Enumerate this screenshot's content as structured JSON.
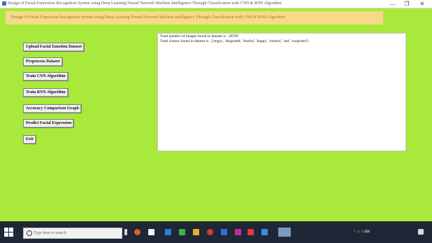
{
  "window": {
    "title": "Design of Facial Expression Recognition System using Deep Learning Neural Network Machine Intelligence Through Classification with CNN & RNN Algorithm",
    "minimize": "—",
    "maximize": "❐",
    "close": "✕"
  },
  "banner": {
    "text": "Design of Facial Expression Recognition System using Deep Learning Neural Network Machine Intelligence Through Classification with CNN & RNN Algorithm"
  },
  "buttons": [
    {
      "label": "Upload Facial Emotion Dataset"
    },
    {
      "label": "Preprocess Dataset"
    },
    {
      "label": "Train CNN Algorithm"
    },
    {
      "label": "Train RNN Algorithm"
    },
    {
      "label": "Accuracy Comparison Graph"
    },
    {
      "label": "Predict Facial Expression"
    },
    {
      "label": "Exit"
    }
  ],
  "output": {
    "line1": "Total number of images found in dataset is : 28709",
    "line2": "Total classes found in dataset is : ['angry', 'disgusted', 'fearful', 'happy', 'neutral', 'sad', 'surprised']"
  },
  "taskbar": {
    "search_placeholder": "Type here to search",
    "time": "",
    "date": ""
  },
  "colors": {
    "background": "#a9e93b",
    "banner": "#f7d98c",
    "banner_text": "#b07020"
  }
}
